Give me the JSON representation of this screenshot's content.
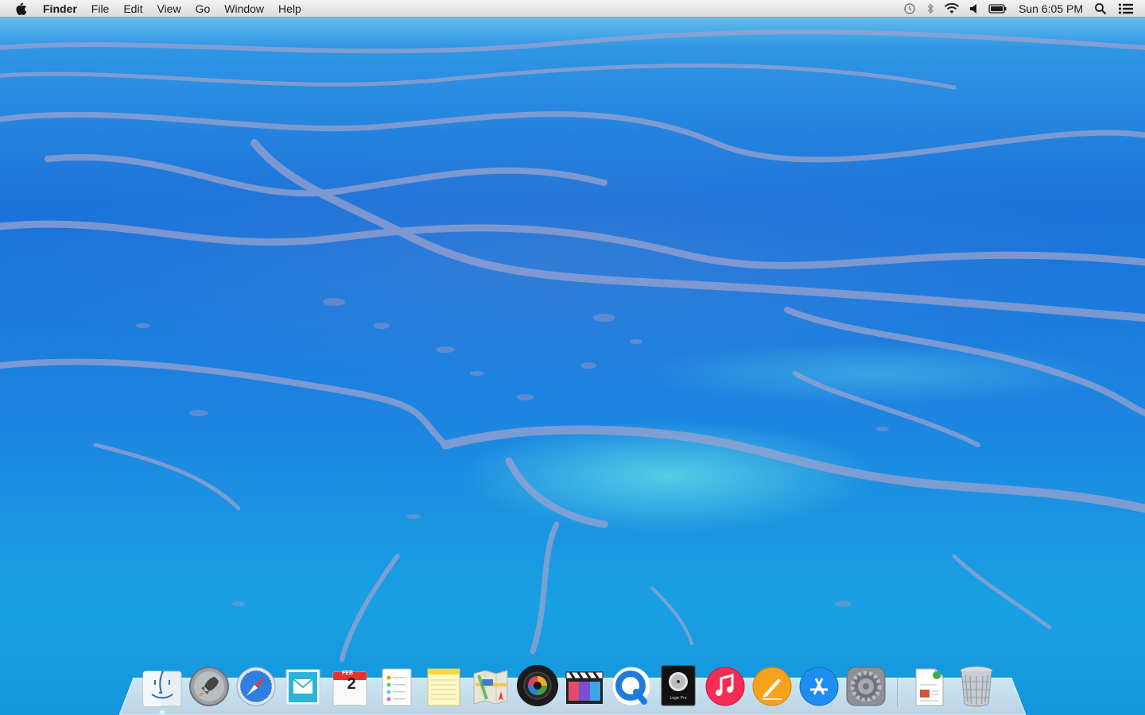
{
  "menubar": {
    "app_name": "Finder",
    "menus": [
      "File",
      "Edit",
      "View",
      "Go",
      "Window",
      "Help"
    ],
    "status_icons": [
      "time-machine-icon",
      "bluetooth-icon",
      "wifi-icon",
      "volume-icon",
      "battery-icon"
    ],
    "clock": "Sun 6:05 PM",
    "right_icons": [
      "spotlight-icon",
      "notification-center-icon"
    ]
  },
  "dock": {
    "apps": [
      {
        "name": "Finder",
        "icon": "finder-icon",
        "running": true
      },
      {
        "name": "Launchpad",
        "icon": "launchpad-icon",
        "running": false
      },
      {
        "name": "Safari",
        "icon": "safari-icon",
        "running": false
      },
      {
        "name": "Mail",
        "icon": "mail-icon",
        "running": false
      },
      {
        "name": "Calendar",
        "icon": "calendar-icon",
        "running": false,
        "month": "FEB",
        "day": "2"
      },
      {
        "name": "Reminders",
        "icon": "reminders-icon",
        "running": false
      },
      {
        "name": "Notes",
        "icon": "notes-icon",
        "running": false
      },
      {
        "name": "Maps",
        "icon": "maps-icon",
        "running": false
      },
      {
        "name": "Photo Booth",
        "icon": "photo-booth-icon",
        "running": false
      },
      {
        "name": "Final Cut Pro",
        "icon": "final-cut-icon",
        "running": false
      },
      {
        "name": "QuickTime Player",
        "icon": "quicktime-icon",
        "running": false
      },
      {
        "name": "Logic Pro",
        "icon": "logic-pro-icon",
        "running": false,
        "label": "Logic Pro"
      },
      {
        "name": "iTunes",
        "icon": "itunes-icon",
        "running": false
      },
      {
        "name": "Pages",
        "icon": "pages-icon",
        "running": false
      },
      {
        "name": "App Store",
        "icon": "app-store-icon",
        "running": false
      },
      {
        "name": "System Preferences",
        "icon": "system-preferences-icon",
        "running": false
      }
    ],
    "stacks": [
      {
        "name": "Document",
        "icon": "document-icon"
      },
      {
        "name": "Trash",
        "icon": "trash-icon"
      }
    ]
  },
  "colors": {
    "menubar": "#e6e6e6",
    "water_deep": "#1a72d9",
    "water_light": "#5fd7e6",
    "reef": "#8c93c8"
  }
}
